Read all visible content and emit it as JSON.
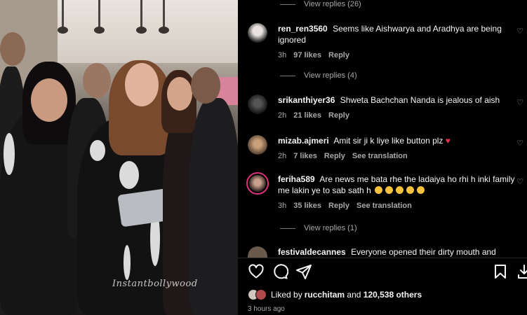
{
  "media": {
    "watermark": "Instantbollywood"
  },
  "threads": [
    {
      "view_replies": "View replies (26)"
    },
    {
      "user": "ren_ren3560",
      "text": "Seems like Aishwarya and Aradhya are being ignored",
      "time": "3h",
      "likes": "97 likes",
      "reply": "Reply",
      "view_replies": "View replies (4)"
    },
    {
      "user": "srikanthiyer36",
      "text": "Shweta Bachchan Nanda is jealous of aish",
      "time": "2h",
      "likes": "21 likes",
      "reply": "Reply"
    },
    {
      "user": "mizab.ajmeri",
      "text": "Amit sir ji k liye like button plz",
      "text_heart": "♥",
      "time": "2h",
      "likes": "7 likes",
      "reply": "Reply",
      "translation": "See translation"
    },
    {
      "user": "feriha589",
      "text": "Are news me bata rhe the ladaiya ho rhi h inki family me lakin ye to sab sath h",
      "time": "3h",
      "likes": "35 likes",
      "reply": "Reply",
      "translation": "See translation",
      "view_replies": "View replies (1)"
    },
    {
      "user": "festivaldecannes",
      "text": "Everyone opened their dirty mouth and"
    }
  ],
  "actions": {
    "like_icon": "heart-icon",
    "comment_icon": "comment-icon",
    "share_icon": "share-icon",
    "save_icon": "bookmark-icon",
    "download_icon": "download-icon"
  },
  "likes_summary": {
    "prefix": "Liked by ",
    "user": "rucchitam",
    "mid": " and ",
    "count": "120,538 others"
  },
  "posted": "3 hours ago",
  "colors": {
    "background": "#000000",
    "text": "#f5f5f5",
    "secondary": "#a8a8a8",
    "heart": "#ed2e4a",
    "story_ring": "#d9317a"
  }
}
